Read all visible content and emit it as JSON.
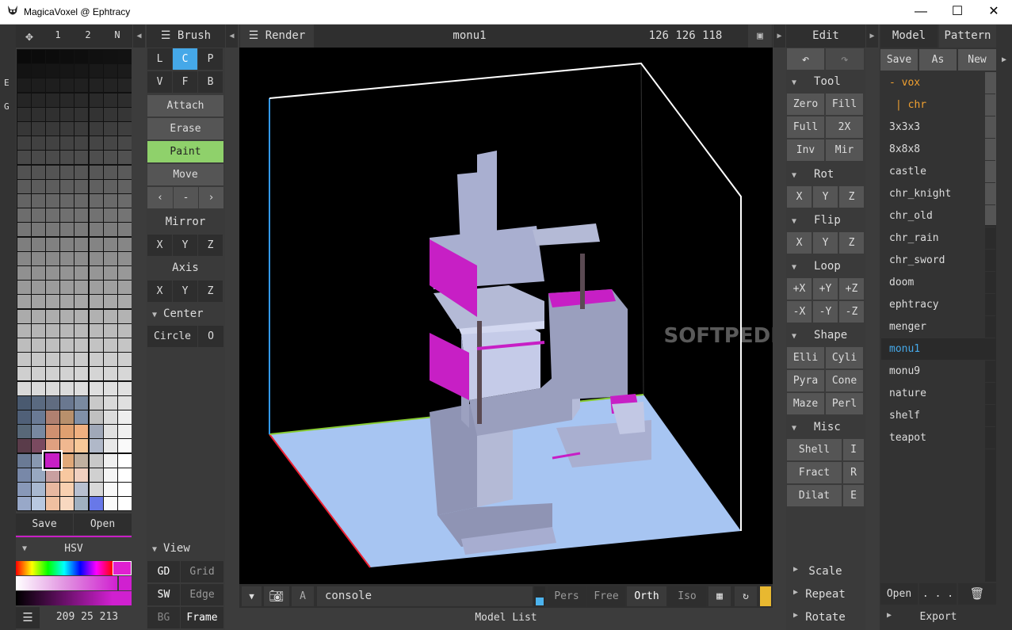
{
  "window": {
    "title": "MagicaVoxel @ Ephtracy",
    "minimize": "—",
    "maximize": "☐",
    "close": "✕"
  },
  "palette_top": {
    "icon": "move-icon",
    "tab1": "1",
    "tab2": "2",
    "tabN": "N"
  },
  "side_letters": {
    "e": "E",
    "g": "G"
  },
  "palette": {
    "save": "Save",
    "open": "Open",
    "hsv_label": "HSV",
    "value": "209 25 213",
    "selected_color": "#c71fc5"
  },
  "brush": {
    "title": "Brush",
    "modes": [
      "L",
      "C",
      "P",
      "V",
      "F",
      "B"
    ],
    "active_mode": "C",
    "actions": [
      "Attach",
      "Erase",
      "Paint",
      "Move"
    ],
    "active_action": "Paint",
    "nav": [
      "‹",
      "-",
      "›"
    ],
    "mirror": "Mirror",
    "mirror_axes": [
      "X",
      "Y",
      "Z"
    ],
    "axis": "Axis",
    "axis_axes": [
      "X",
      "Y",
      "Z"
    ],
    "center": "Center",
    "circle": "Circle",
    "circle_o": "O",
    "view": "View",
    "gd": "GD",
    "grid": "Grid",
    "sw": "SW",
    "edge": "Edge",
    "bg": "BG",
    "frame": "Frame"
  },
  "render": {
    "label": "Render",
    "model_name": "monu1",
    "dims": "126 126 118"
  },
  "bottom": {
    "a": "A",
    "console": "console",
    "pers": "Pers",
    "free": "Free",
    "orth": "Orth",
    "iso": "Iso",
    "model_list": "Model List"
  },
  "edit": {
    "title": "Edit",
    "tool": "Tool",
    "tool_btns": [
      "Zero",
      "Fill",
      "Full",
      "2X",
      "Inv",
      "Mir"
    ],
    "rot": "Rot",
    "flip": "Flip",
    "xyz": [
      "X",
      "Y",
      "Z"
    ],
    "loop": "Loop",
    "loop_btns": [
      "+X",
      "+Y",
      "+Z",
      "-X",
      "-Y",
      "-Z"
    ],
    "shape": "Shape",
    "shape_btns": [
      "Elli",
      "Cyli",
      "Pyra",
      "Cone",
      "Maze",
      "Perl"
    ],
    "misc": "Misc",
    "misc_btns": [
      "Shell",
      "I",
      "Fract",
      "R",
      "Dilat",
      "E"
    ],
    "scale": "Scale",
    "repeat": "Repeat",
    "rotate": "Rotate"
  },
  "models": {
    "tab_model": "Model",
    "tab_pattern": "Pattern",
    "save": "Save",
    "as": "As",
    "new": "New",
    "items": [
      "- vox",
      "| chr",
      "3x3x3",
      "8x8x8",
      "castle",
      "chr_knight",
      "chr_old",
      "chr_rain",
      "chr_sword",
      "doom",
      "ephtracy",
      "menger",
      "monu1",
      "monu9",
      "nature",
      "shelf",
      "teapot"
    ],
    "selected": "monu1",
    "open": "Open",
    "more": ". . .",
    "export": "Export"
  },
  "watermark": "SOFTPEDIA"
}
